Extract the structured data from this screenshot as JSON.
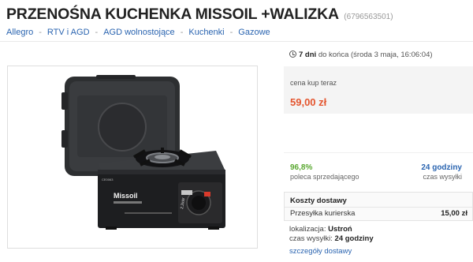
{
  "listing": {
    "title": "PRZENOŚNA KUCHENKA MISSOIL +WALIZKA",
    "item_id": "(6796563501)"
  },
  "breadcrumb": {
    "items": [
      "Allegro",
      "RTV i AGD",
      "AGD wolnostojące",
      "Kuchenki",
      "Gazowe"
    ],
    "separator": "-"
  },
  "timer": {
    "icon": "clock-icon",
    "remaining": "7 dni",
    "suffix": "do końca (środa 3 maja, 16:06:04)"
  },
  "price": {
    "label": "cena kup teraz",
    "value": "59,00 zł"
  },
  "seller_stats": {
    "rating": "96,8%",
    "rating_desc": "poleca sprzedającego",
    "shipping_time": "24 godziny",
    "shipping_time_desc": "czas wysyłki"
  },
  "delivery": {
    "title": "Koszty dostawy",
    "method": "Przesyłka kurierska",
    "cost": "15,00 zł"
  },
  "location": {
    "location_label": "lokalizacja:",
    "location_value": "Ustroń",
    "time_label": "czas wysyłki:",
    "time_value": "24 godziny",
    "details_link": "szczegóły dostawy"
  },
  "photo": {
    "device_brand": "Missoil",
    "device_badge": "CE0063",
    "device_sticker": "2.2kW"
  },
  "colors": {
    "accent_link": "#2a64b0",
    "price": "#e4552e",
    "rating": "#5aa831"
  }
}
